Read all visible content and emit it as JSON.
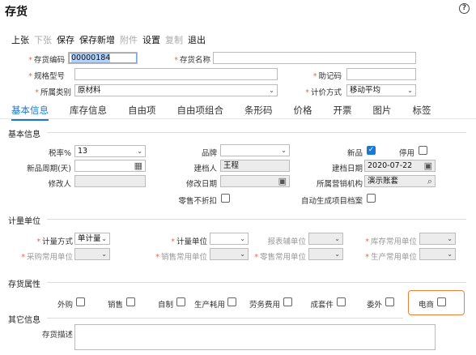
{
  "page": {
    "title": "存货",
    "help_icon": "?"
  },
  "toolbar": {
    "items": [
      {
        "label": "上张",
        "enabled": true
      },
      {
        "label": "下张",
        "enabled": false
      },
      {
        "label": "保存",
        "enabled": true
      },
      {
        "label": "保存新增",
        "enabled": true
      },
      {
        "label": "附件",
        "enabled": false
      },
      {
        "label": "设置",
        "enabled": true
      },
      {
        "label": "复制",
        "enabled": false
      },
      {
        "label": "退出",
        "enabled": true
      }
    ]
  },
  "header": {
    "code_label": "存货编码",
    "code_value": "00000184",
    "name_label": "存货名称",
    "name_value": "",
    "spec_label": "规格型号",
    "spec_value": "",
    "memo_label": "助记码",
    "memo_value": "",
    "category_label": "所属类别",
    "category_value": "原材料",
    "pricing_label": "计价方式",
    "pricing_value": "移动平均"
  },
  "tabs": [
    "基本信息",
    "库存信息",
    "自由项",
    "自由项组合",
    "条形码",
    "价格",
    "开票",
    "图片",
    "标签"
  ],
  "basic": {
    "section": "基本信息",
    "tax_label": "税率%",
    "tax_value": "13",
    "brand_label": "品牌",
    "brand_value": "",
    "new_label": "新品",
    "new_checked": true,
    "disabled_label": "停用",
    "disabled_checked": false,
    "cycle_label": "新品周期(天)",
    "cycle_value": "",
    "creator_label": "建档人",
    "creator_value": "王程",
    "create_date_label": "建档日期",
    "create_date_value": "2020-07-22",
    "modifier_label": "修改人",
    "modifier_value": "",
    "modify_date_label": "修改日期",
    "modify_date_value": "",
    "org_label": "所属营销机构",
    "org_value": "演示账套",
    "no_discount_label": "零售不折扣",
    "auto_archive_label": "自动生成项目档案"
  },
  "units": {
    "section": "计量单位",
    "method_label": "计量方式",
    "method_value": "单计量",
    "unit_label": "计量单位",
    "unit_value": "",
    "report_label": "报表辅单位",
    "stock_common_label": "库存常用单位",
    "purchase_common_label": "采购常用单位",
    "sales_common_label": "销售常用单位",
    "retail_common_label": "零售常用单位",
    "production_common_label": "生产常用单位"
  },
  "attrs": {
    "section": "存货属性",
    "items": [
      "外购",
      "销售",
      "自制",
      "生产耗用",
      "劳务费用",
      "成套件",
      "委外",
      "电商"
    ]
  },
  "other": {
    "section": "其它信息",
    "desc_label": "存货描述",
    "desc_value": ""
  },
  "colors": {
    "accent": "#1a78d6",
    "highlight": "#e8803a"
  }
}
